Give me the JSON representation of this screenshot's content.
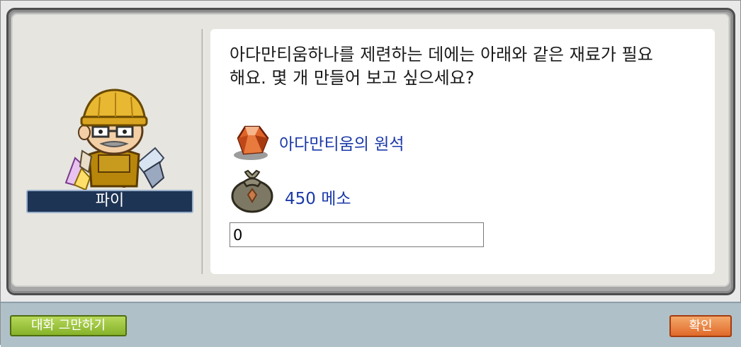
{
  "npc": {
    "name": "파이"
  },
  "message": {
    "line1": "아다만티움하나를 제련하는 데에는 아래와 같은 재료가 필요",
    "line2": "해요. 몇 개 만들어 보고 싶으세요?"
  },
  "items": [
    {
      "icon": "ore-gem-icon",
      "label": "아다만티움의 원석"
    },
    {
      "icon": "meso-bag-icon",
      "label": "450 메소"
    }
  ],
  "quantity_input": {
    "value": "0"
  },
  "buttons": {
    "end_chat": "대화 그만하기",
    "confirm": "확인"
  },
  "colors": {
    "item_text": "#1c3aa8",
    "end_button": "#9cc43e",
    "ok_button": "#ea8444",
    "name_bg": "#1e3455"
  }
}
